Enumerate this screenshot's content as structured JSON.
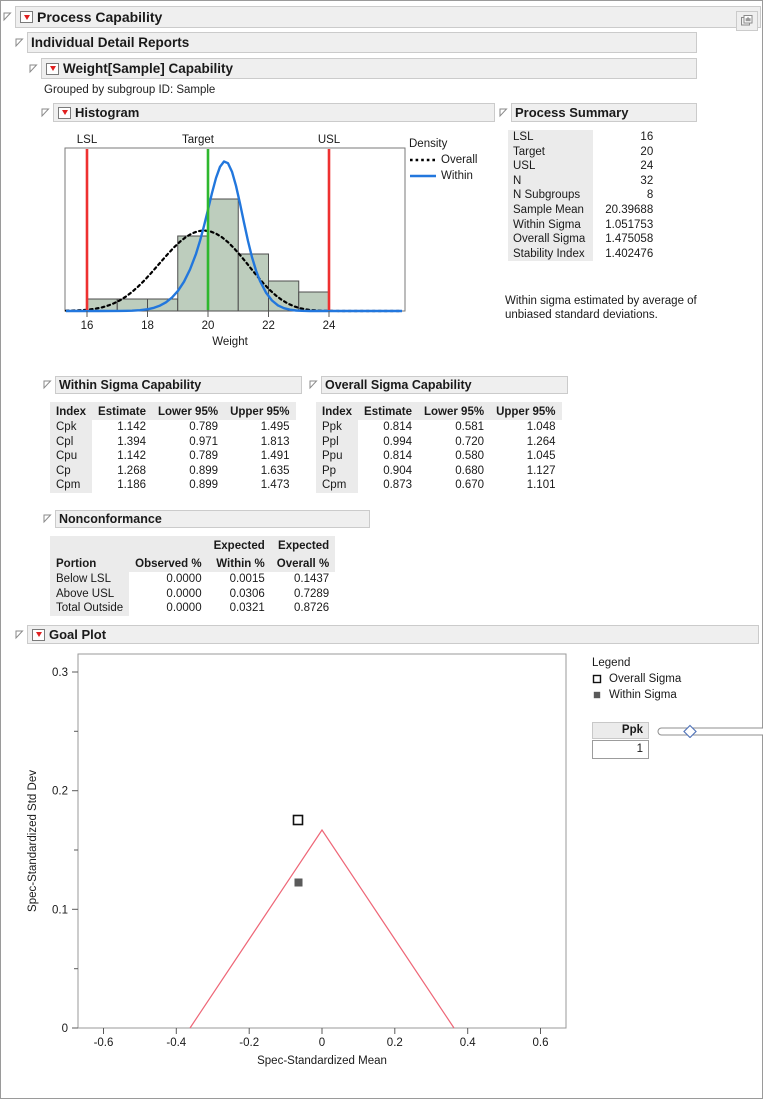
{
  "window": {
    "title": "Process Capability",
    "corner_icon": "window-restore-icon"
  },
  "sections": {
    "individual_detail_reports": "Individual Detail Reports",
    "weight_sample_capability": "Weight[Sample] Capability",
    "grouped_note": "Grouped by subgroup ID: Sample",
    "histogram": "Histogram",
    "process_summary": "Process Summary",
    "within_sigma_capability": "Within Sigma Capability",
    "overall_sigma_capability": "Overall Sigma Capability",
    "nonconformance": "Nonconformance",
    "goal_plot": "Goal Plot"
  },
  "process_summary": {
    "rows": [
      {
        "label": "LSL",
        "value": "16"
      },
      {
        "label": "Target",
        "value": "20"
      },
      {
        "label": "USL",
        "value": "24"
      },
      {
        "label": "N",
        "value": "32"
      },
      {
        "label": "N Subgroups",
        "value": "8"
      },
      {
        "label": "Sample Mean",
        "value": "20.39688"
      },
      {
        "label": "Within Sigma",
        "value": "1.051753"
      },
      {
        "label": "Overall Sigma",
        "value": "1.475058"
      },
      {
        "label": "Stability Index",
        "value": "1.402476"
      }
    ],
    "note": "Within sigma estimated by average of unbiased standard deviations."
  },
  "within_sigma": {
    "headers": [
      "Index",
      "Estimate",
      "Lower 95%",
      "Upper 95%"
    ],
    "rows": [
      [
        "Cpk",
        "1.142",
        "0.789",
        "1.495"
      ],
      [
        "Cpl",
        "1.394",
        "0.971",
        "1.813"
      ],
      [
        "Cpu",
        "1.142",
        "0.789",
        "1.491"
      ],
      [
        "Cp",
        "1.268",
        "0.899",
        "1.635"
      ],
      [
        "Cpm",
        "1.186",
        "0.899",
        "1.473"
      ]
    ]
  },
  "overall_sigma": {
    "headers": [
      "Index",
      "Estimate",
      "Lower 95%",
      "Upper 95%"
    ],
    "rows": [
      [
        "Ppk",
        "0.814",
        "0.581",
        "1.048"
      ],
      [
        "Ppl",
        "0.994",
        "0.720",
        "1.264"
      ],
      [
        "Ppu",
        "0.814",
        "0.580",
        "1.045"
      ],
      [
        "Pp",
        "0.904",
        "0.680",
        "1.127"
      ],
      [
        "Cpm",
        "0.873",
        "0.670",
        "1.101"
      ]
    ]
  },
  "nonconformance": {
    "headers": [
      "Portion",
      "Observed %",
      "Expected\nWithin %",
      "Expected\nOverall %"
    ],
    "headers_line1": [
      "",
      "",
      "Expected",
      "Expected"
    ],
    "headers_line2": [
      "Portion",
      "Observed %",
      "Within %",
      "Overall %"
    ],
    "rows": [
      [
        "Below LSL",
        "0.0000",
        "0.0015",
        "0.1437"
      ],
      [
        "Above USL",
        "0.0000",
        "0.0306",
        "0.7289"
      ],
      [
        "Total Outside",
        "0.0000",
        "0.0321",
        "0.8726"
      ]
    ]
  },
  "histogram_legend": {
    "title": "Density",
    "items": [
      {
        "label": "Overall",
        "style": "dotted-black"
      },
      {
        "label": "Within",
        "style": "solid-blue"
      }
    ]
  },
  "goal_legend": {
    "title": "Legend",
    "items": [
      {
        "label": "Overall Sigma",
        "marker": "open-square"
      },
      {
        "label": "Within Sigma",
        "marker": "filled-square"
      }
    ]
  },
  "ppk_control": {
    "label": "Ppk",
    "value": "1",
    "slider_position_pct": 30
  },
  "colors": {
    "spec_limit_line": "#ee3030",
    "target_line": "#2eb82e",
    "within_curve": "#2277dd",
    "overall_curve": "#000000",
    "bar_fill": "#bdcdbd",
    "bar_stroke": "#4d4d4d",
    "goal_triangle": "#ee6677",
    "header_bg": "#efefef",
    "table_label_bg": "#ebebeb"
  },
  "chart_data": [
    {
      "type": "bar",
      "name": "histogram",
      "title": "Histogram",
      "xlabel": "Weight",
      "ylabel": "",
      "xlim": [
        15.0,
        25.4
      ],
      "xticks": [
        16,
        18,
        20,
        22,
        24
      ],
      "xtick_labels": [
        "16",
        "18",
        "20",
        "22",
        "24"
      ],
      "bin_edges": [
        16,
        17,
        18,
        19,
        20,
        21,
        22,
        23,
        24
      ],
      "bin_width": 1,
      "bars": [
        {
          "x0": 16,
          "x1": 17,
          "height": 1
        },
        {
          "x0": 17,
          "x1": 18,
          "height": 1
        },
        {
          "x0": 18,
          "x1": 19,
          "height": 1
        },
        {
          "x0": 19,
          "x1": 20,
          "height": 6
        },
        {
          "x0": 20,
          "x1": 21,
          "height": 9
        },
        {
          "x0": 21,
          "x1": 22,
          "height": 5
        },
        {
          "x0": 22,
          "x1": 23,
          "height": 3
        },
        {
          "x0": 23,
          "x1": 24,
          "height": 2
        }
      ],
      "reference_lines": [
        {
          "label": "LSL",
          "value": 16,
          "color": "#ee3030"
        },
        {
          "label": "Target",
          "value": 20,
          "color": "#2eb82e"
        },
        {
          "label": "USL",
          "value": 24,
          "color": "#ee3030"
        }
      ],
      "curves": [
        {
          "name": "Overall",
          "mean": 20.39688,
          "sigma": 1.475058,
          "style": "dotted",
          "color": "#000000"
        },
        {
          "name": "Within",
          "mean": 20.39688,
          "sigma": 1.051753,
          "style": "solid",
          "color": "#2277dd"
        }
      ],
      "legend_title": "Density",
      "legend_position": "right",
      "grid": false
    },
    {
      "type": "scatter",
      "name": "goal-plot",
      "title": "Goal Plot",
      "xlabel": "Spec-Standardized Mean",
      "ylabel": "Spec-Standardized Std Dev",
      "xlim": [
        -0.65,
        0.65
      ],
      "ylim": [
        0,
        0.315
      ],
      "xticks": [
        -0.6,
        -0.4,
        -0.2,
        0,
        0.2,
        0.4,
        0.6
      ],
      "xtick_labels": [
        "-0.6",
        "-0.4",
        "-0.2",
        "0",
        "0.2",
        "0.4",
        "0.6"
      ],
      "yticks": [
        0,
        0.1,
        0.2,
        0.3
      ],
      "ytick_labels": [
        "0",
        "0.1",
        "0.2",
        "0.3"
      ],
      "yticks_minor": [
        0.05,
        0.15,
        0.25
      ],
      "points": [
        {
          "series": "Overall Sigma",
          "x": 0.032,
          "y": 0.184,
          "marker": "open-square"
        },
        {
          "series": "Within Sigma",
          "x": 0.032,
          "y": 0.131,
          "marker": "filled-square"
        }
      ],
      "goal_triangle": {
        "apex": [
          0,
          0.1667
        ],
        "left": [
          -0.5,
          0
        ],
        "right": [
          0.5,
          0
        ],
        "color": "#ee6677"
      },
      "grid": false,
      "legend_position": "right"
    }
  ]
}
